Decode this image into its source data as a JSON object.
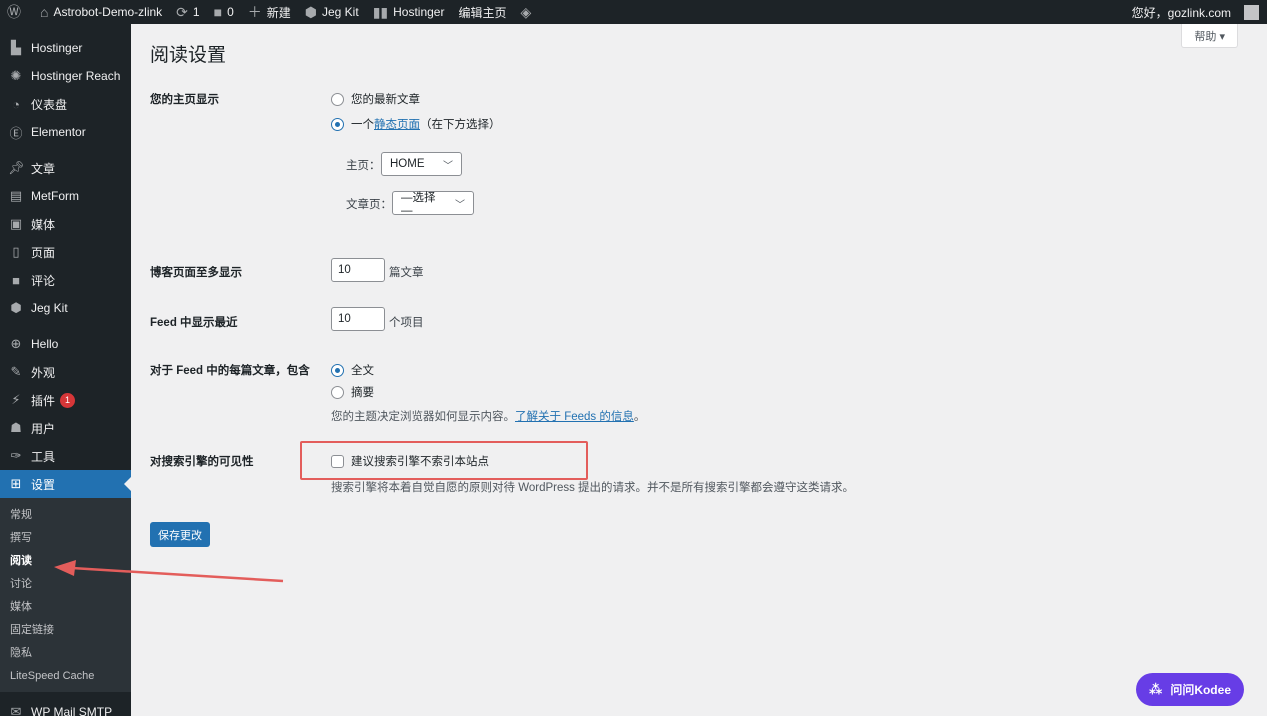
{
  "adminbar": {
    "site_name": "Astrobot-Demo-zlink",
    "updates_count": "1",
    "comments_count": "0",
    "new_label": "新建",
    "jegkit_label": "Jeg Kit",
    "hostinger_label": "Hostinger",
    "edit_home_label": "编辑主页",
    "greeting": "您好，gozlink.com"
  },
  "sidebar": {
    "items": [
      {
        "label": "Hostinger",
        "icon": "hostinger-icon"
      },
      {
        "label": "Hostinger Reach",
        "icon": "reach-icon"
      },
      {
        "label": "仪表盘",
        "icon": "dashboard-icon"
      },
      {
        "label": "Elementor",
        "icon": "elementor-icon"
      },
      {
        "label": "文章",
        "icon": "pin-icon"
      },
      {
        "label": "MetForm",
        "icon": "form-icon"
      },
      {
        "label": "媒体",
        "icon": "media-icon"
      },
      {
        "label": "页面",
        "icon": "page-icon"
      },
      {
        "label": "评论",
        "icon": "comment-icon"
      },
      {
        "label": "Jeg Kit",
        "icon": "jegkit-icon"
      },
      {
        "label": "Hello",
        "icon": "hello-icon"
      },
      {
        "label": "外观",
        "icon": "appearance-icon"
      },
      {
        "label": "插件",
        "icon": "plugin-icon",
        "badge": "1"
      },
      {
        "label": "用户",
        "icon": "user-icon"
      },
      {
        "label": "工具",
        "icon": "tools-icon"
      },
      {
        "label": "设置",
        "icon": "settings-icon"
      }
    ],
    "submenu": [
      "常规",
      "撰写",
      "阅读",
      "讨论",
      "媒体",
      "固定链接",
      "隐私",
      "LiteSpeed Cache"
    ],
    "after": "WP Mail SMTP"
  },
  "help_label": "帮助 ▾",
  "page_title": "阅读设置",
  "homepage": {
    "label": "您的主页显示",
    "option_latest": "您的最新文章",
    "option_static_prefix": "一个",
    "option_static_link": "静态页面",
    "option_static_suffix": "（在下方选择）",
    "front_label": "主页：",
    "front_value": "HOME",
    "posts_label": "文章页：",
    "posts_value": "—选择—"
  },
  "blog_pages": {
    "label": "博客页面至多显示",
    "value": "10",
    "unit": "篇文章"
  },
  "feed_items": {
    "label": "Feed 中显示最近",
    "value": "10",
    "unit": "个项目"
  },
  "feed_content": {
    "label": "对于 Feed 中的每篇文章，包含",
    "option_full": "全文",
    "option_excerpt": "摘要",
    "desc_prefix": "您的主题决定浏览器如何显示内容。",
    "desc_link": "了解关于 Feeds 的信息",
    "desc_suffix": "。"
  },
  "visibility": {
    "label": "对搜索引擎的可见性",
    "checkbox_label": "建议搜索引擎不索引本站点",
    "desc": "搜索引擎将本着自觉自愿的原则对待 WordPress 提出的请求。并不是所有搜索引擎都会遵守这类请求。"
  },
  "save_label": "保存更改",
  "kodee_label": "问问Kodee"
}
